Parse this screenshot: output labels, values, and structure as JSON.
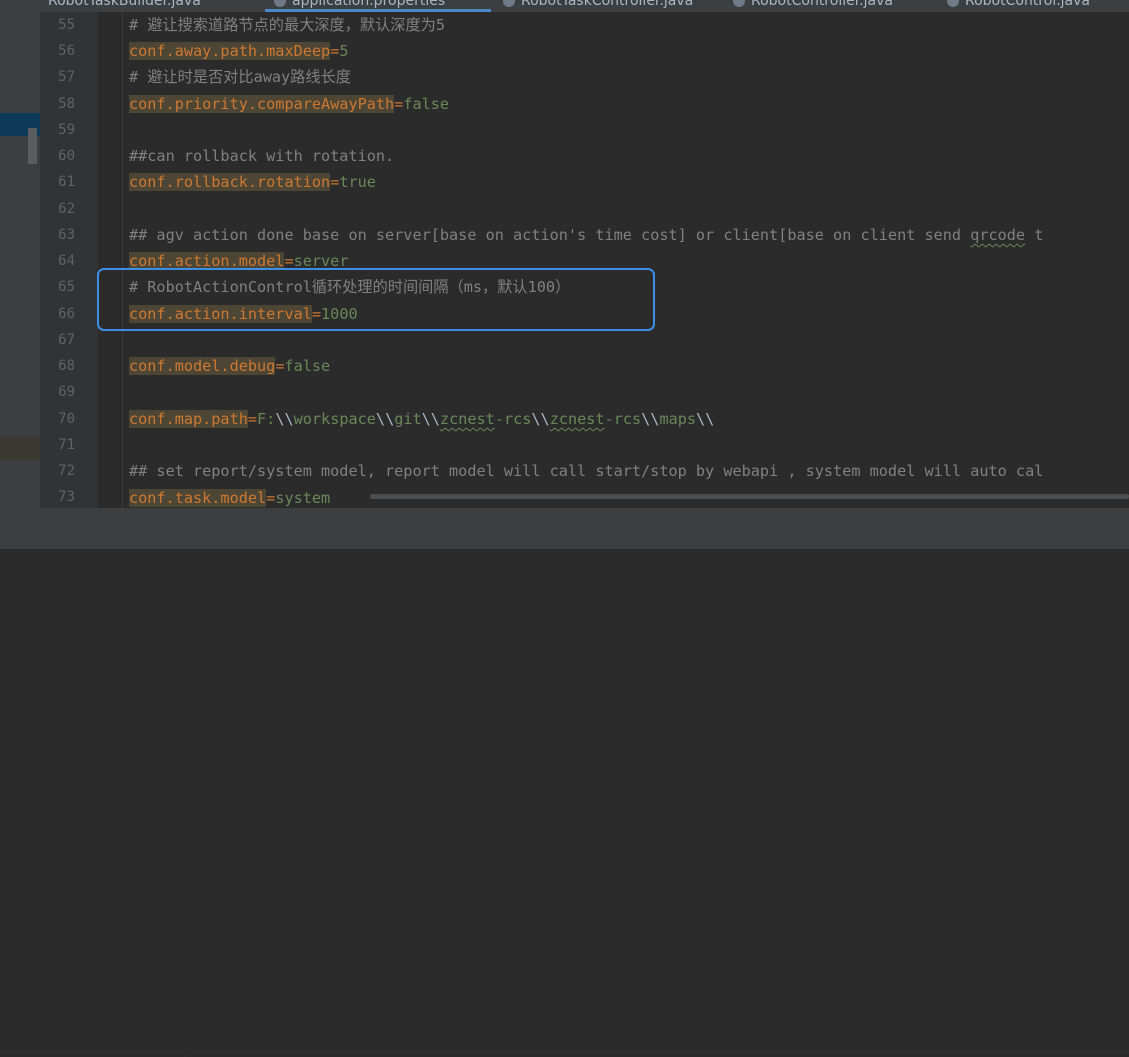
{
  "tabs": [
    {
      "label": "RobotTaskBuilder.java"
    },
    {
      "label": "application.properties"
    },
    {
      "label": "RobotTaskController.java"
    },
    {
      "label": "RobotController.java"
    },
    {
      "label": "RobotControl.java"
    }
  ],
  "lines": [
    {
      "n": "55",
      "comment": "# 避让搜索道路节点的最大深度，默认深度为5"
    },
    {
      "n": "56",
      "key": "conf.away.path.maxDeep",
      "value": "5"
    },
    {
      "n": "57",
      "comment": "# 避让时是否对比away路线长度"
    },
    {
      "n": "58",
      "key": "conf.priority.compareAwayPath",
      "value": "false"
    },
    {
      "n": "59"
    },
    {
      "n": "60",
      "comment": "##can rollback with rotation."
    },
    {
      "n": "61",
      "key": "conf.rollback.rotation",
      "value": "true"
    },
    {
      "n": "62"
    },
    {
      "n": "63",
      "comment": "## agv action done base on server[base on action's time cost] or client[base on client send ",
      "comment_squiggle": "qrcode",
      "comment_tail": " t"
    },
    {
      "n": "64",
      "key": "conf.action.model",
      "value": "server"
    },
    {
      "n": "65",
      "comment": "# RobotActionControl循环处理的时间间隔（ms，默认100）"
    },
    {
      "n": "66",
      "key": "conf.action.interval",
      "value": "1000"
    },
    {
      "n": "67"
    },
    {
      "n": "68",
      "key": "conf.model.debug",
      "value": "false"
    },
    {
      "n": "69"
    },
    {
      "n": "70",
      "key": "conf.map.path",
      "path": {
        "drive": "F:",
        "sep": "\\\\",
        "p1": "workspace",
        "p2": "git",
        "p3a": "zcnest",
        "p3b": "-rcs",
        "p4a": "zcnest",
        "p4b": "-rcs",
        "p5": "maps"
      }
    },
    {
      "n": "71"
    },
    {
      "n": "72",
      "comment": "## set report/system model, report model will call start/stop by webapi , system model will auto cal"
    },
    {
      "n": "73",
      "key": "conf.task.model",
      "value": "system"
    }
  ],
  "colors": {
    "background": "#2b2b2b",
    "comment": "#808080",
    "key": "#cc7832",
    "value": "#6a8759",
    "highlight_box": "#3d8fe6"
  }
}
